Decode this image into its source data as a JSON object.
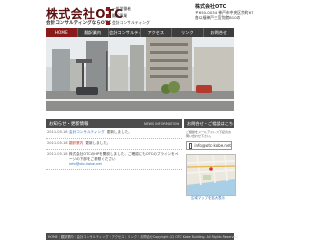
{
  "header": {
    "logo": "株式会社OTC",
    "logo_sub": "会計コンサルティングならOTC",
    "badges": [
      "一般労働者",
      "翻訳事業",
      "会計コンサルティング"
    ],
    "company_name": "株式会社OTC",
    "address_1": "〒650-0034 神戸市中央区京町67",
    "address_2": "各以福神戸三宮別館B10の"
  },
  "nav": {
    "items": [
      "HOME",
      "翻訳業内",
      "会計コンサルティング",
      "アクセス",
      "リンク",
      "お問合せ"
    ]
  },
  "news": {
    "title": "お知らせ・更新情報",
    "title_en": "NEWS INFORMATION",
    "rows": [
      {
        "date": "2011.05.18",
        "tag": "会計コンサルティング",
        "text": "更新しました。"
      },
      {
        "date": "2011.05.18",
        "tag": "翻訳業内",
        "text": "更新しました。"
      },
      {
        "date": "2011.05.18",
        "text": "株式会社OTCのHPを開設しました。ご確認にもOTCのプラインをページの下部をご参照ください",
        "link": "info@otc-kobe.net"
      }
    ]
  },
  "contact": {
    "title": "お問合せ・ご相談はこちら",
    "note": "ご相談をメールアドレス下記のお問い合わせ下さい。",
    "email": "info@otc-kobe.net",
    "map_link": "広域マップを拡大表示"
  },
  "footer": {
    "links": "HOME｜翻訳業内｜会計コンサルティング｜アクセス｜リンク｜お問合せ",
    "copyright": "Copyright (C) OTC Kobe Building. All Rights Reserved."
  }
}
